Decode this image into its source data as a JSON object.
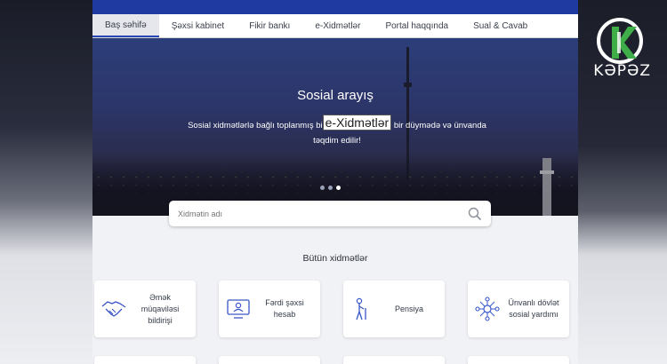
{
  "nav": {
    "items": [
      {
        "label": "Baş səhifə",
        "active": true
      },
      {
        "label": "Şəxsi kabinet"
      },
      {
        "label": "Fikir bankı"
      },
      {
        "label": "e-Xidmətlər"
      },
      {
        "label": "Portal haqqında"
      },
      {
        "label": "Sual & Cavab"
      }
    ]
  },
  "hero": {
    "title": "Sosial arayış",
    "subtitle_before": "Sosial xidmətlərlə bağlı toplanmış bi",
    "subtitle_highlight": "e-Xidmətlər",
    "subtitle_after": " bir düymədə və ünvanda",
    "subtitle_line2": "təqdim edilir!"
  },
  "search": {
    "placeholder": "Xidmətin adı"
  },
  "section": {
    "title": "Bütün xidmətlər"
  },
  "cards": [
    {
      "label": "Əmək müqaviləsi bildirişi",
      "icon": "handshake-icon"
    },
    {
      "label": "Fərdi şəxsi hesab",
      "icon": "monitor-user-icon"
    },
    {
      "label": "Pensiya",
      "icon": "elderly-person-icon"
    },
    {
      "label": "Ünvanlı dövlət sosial yardımı",
      "icon": "network-people-icon"
    }
  ],
  "watermark": {
    "text": "KƏPƏZ"
  },
  "colors": {
    "brand_blue": "#1f3aa0",
    "icon_blue": "#3a56c8",
    "logo_green": "#3fae49"
  }
}
